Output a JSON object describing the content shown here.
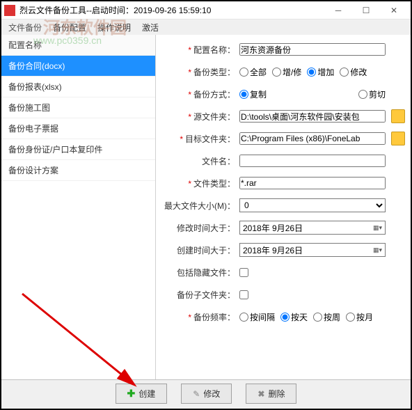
{
  "window": {
    "title": "烈云文件备份工具--启动时间：2019-09-26 15:59:10"
  },
  "menubar": {
    "tab1": "文件备份",
    "item1": "备份配置",
    "item2": "操作说明",
    "item3": "激活"
  },
  "watermark": {
    "logo": "河东软件园",
    "url": "www.pc0359.cn"
  },
  "sidebar": {
    "header": "配置名称",
    "items": [
      "备份合同(docx)",
      "备份报表(xlsx)",
      "备份施工图",
      "备份电子票据",
      "备份身份证/户口本复印件",
      "备份设计方案"
    ]
  },
  "form": {
    "configName": {
      "label": "配置名称：",
      "value": "河东资源备份"
    },
    "backupType": {
      "label": "备份类型：",
      "options": [
        "全部",
        "增/修",
        "增加",
        "修改"
      ],
      "selected": "增加"
    },
    "backupMode": {
      "label": "备份方式：",
      "options": [
        "复制",
        "剪切"
      ],
      "selected": "复制"
    },
    "srcFolder": {
      "label": "源文件夹：",
      "value": "D:\\tools\\桌面\\河东软件园\\安装包"
    },
    "dstFolder": {
      "label": "目标文件夹：",
      "value": "C:\\Program Files (x86)\\FoneLab"
    },
    "fileName": {
      "label": "文件名：",
      "value": ""
    },
    "fileType": {
      "label": "文件类型：",
      "value": "*.rar"
    },
    "maxSize": {
      "label": "最大文件大小(M)：",
      "value": "0"
    },
    "modAfter": {
      "label": "修改时间大于：",
      "value": "2018年 9月26日"
    },
    "createAfter": {
      "label": "创建时间大于：",
      "value": "2018年 9月26日"
    },
    "includeHidden": {
      "label": "包括隐藏文件：",
      "checked": false
    },
    "subfolders": {
      "label": "备份子文件夹：",
      "checked": false
    },
    "freq": {
      "label": "备份频率：",
      "options": [
        "按间隔",
        "按天",
        "按周",
        "按月"
      ],
      "selected": "按天"
    }
  },
  "buttons": {
    "create": "创建",
    "modify": "修改",
    "delete": "删除"
  }
}
